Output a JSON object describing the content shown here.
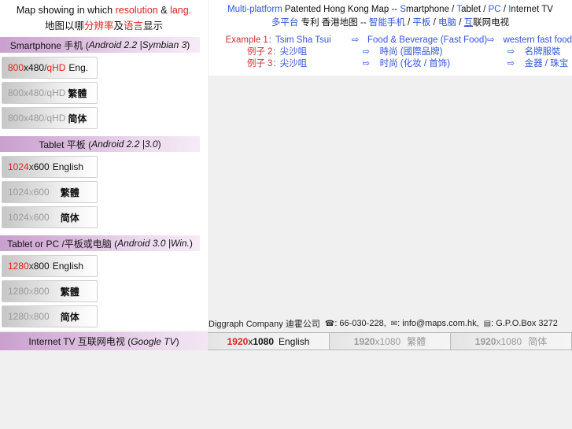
{
  "left_panel": {
    "title": {
      "line1_a": "Map showing in which ",
      "line1_b": "resolution",
      "line1_c": " & ",
      "line1_d": "lang.",
      "line2_a": "地图以哪",
      "line2_b": "分辨率",
      "line2_c": "及",
      "line2_d": "语言",
      "line2_e": "显示"
    },
    "groups": [
      {
        "header_main": "Smartphone 手机 (",
        "header_em": "Android 2.2 |Symbian 3",
        "header_end": ")",
        "buttons": [
          {
            "num": "800",
            "rest": "x480",
            "sep": " / ",
            "qhd": "qHD",
            "lang": "Eng.",
            "active": true
          },
          {
            "num": "800",
            "rest": "x480",
            "sep": " / ",
            "qhd": "qHD",
            "lang": "繁體",
            "active": false
          },
          {
            "num": "800",
            "rest": "x480",
            "sep": " / ",
            "qhd": "qHD",
            "lang": "简体",
            "active": false
          }
        ]
      },
      {
        "header_main": "Tablet 平板 (",
        "header_em": "Android 2.2 |3.0",
        "header_end": ")",
        "buttons": [
          {
            "num": "1024",
            "rest": "",
            "sep": " x ",
            "qhd": "600",
            "lang": "English",
            "active": true
          },
          {
            "num": "1024",
            "rest": "",
            "sep": " x ",
            "qhd": "600",
            "lang": "繁體",
            "active": false
          },
          {
            "num": "1024",
            "rest": "",
            "sep": " x ",
            "qhd": "600",
            "lang": "简体",
            "active": false
          }
        ]
      },
      {
        "header_main": "Tablet or PC /平板或电脑 (",
        "header_em": "Android 3.0 |Win.",
        "header_end": ")",
        "buttons": [
          {
            "num": "1280",
            "rest": "",
            "sep": " x ",
            "qhd": "800",
            "lang": "English",
            "active": true
          },
          {
            "num": "1280",
            "rest": "",
            "sep": " x ",
            "qhd": "800",
            "lang": "繁體",
            "active": false
          },
          {
            "num": "1280",
            "rest": "",
            "sep": " x ",
            "qhd": "800",
            "lang": "简体",
            "active": false
          }
        ]
      }
    ]
  },
  "right_panel": {
    "headline_en": {
      "a": "Multi-platform",
      "b": " Patented Hong Kong Map -- ",
      "c": "S",
      "d": "martphone / ",
      "e": "T",
      "f": "ablet / ",
      "g": "PC",
      "h": " / ",
      "i": "I",
      "j": "nternet TV"
    },
    "headline_cn": {
      "a": "多平台",
      "b": " 专利 香港地图 -- ",
      "c": "智能手机",
      "d": " / ",
      "e": "平板",
      "f": " / ",
      "g": "电脑",
      "h": " / ",
      "i": "互",
      "j": "联网电视"
    },
    "examples": [
      {
        "label": "Example",
        "num": "1",
        "colon": ":",
        "place": "Tsim Sha Tsui",
        "arrow": "⇨",
        "category": "Food & Beverage (Fast Food)",
        "arrow2": "⇨",
        "result": "western fast food"
      },
      {
        "label": "例子",
        "num": "2",
        "colon": ":",
        "place": "尖沙咀",
        "arrow": "⇨",
        "category": "時尚 (國際品牌)",
        "arrow2": "⇨",
        "result": "名牌服裝"
      },
      {
        "label": "例子",
        "num": "3",
        "colon": ":",
        "place": "尖沙咀",
        "arrow": "⇨",
        "category": "时尚 (化妆 / 首饰)",
        "arrow2": "⇨",
        "result": "金器 / 珠宝"
      }
    ]
  },
  "footer": {
    "company": "Diggraph Company 迪霍公司",
    "phone_icon": "☎",
    "phone": ": 66-030-228,",
    "mail_icon": "✉",
    "email": ": info@maps.com.hk,",
    "box_icon": "▤",
    "box": ": G.P.O.Box 3272"
  },
  "tv_row": {
    "label_main": "Internet TV 互联网电视 (",
    "label_em": "Google TV",
    "label_end": ")",
    "buttons": [
      {
        "num": "1920",
        "sep": " x ",
        "val": "1080",
        "lang": "English",
        "active": true
      },
      {
        "num": "1920",
        "sep": " x ",
        "val": "1080",
        "lang": "繁體",
        "active": false
      },
      {
        "num": "1920",
        "sep": " x ",
        "val": "1080",
        "lang": "简体",
        "active": false
      }
    ]
  },
  "colors": {
    "accent_red": "#e02020",
    "accent_blue": "#3355dd",
    "header_purple": "#c9a0ce",
    "page_bg": "#f0f0f0"
  }
}
